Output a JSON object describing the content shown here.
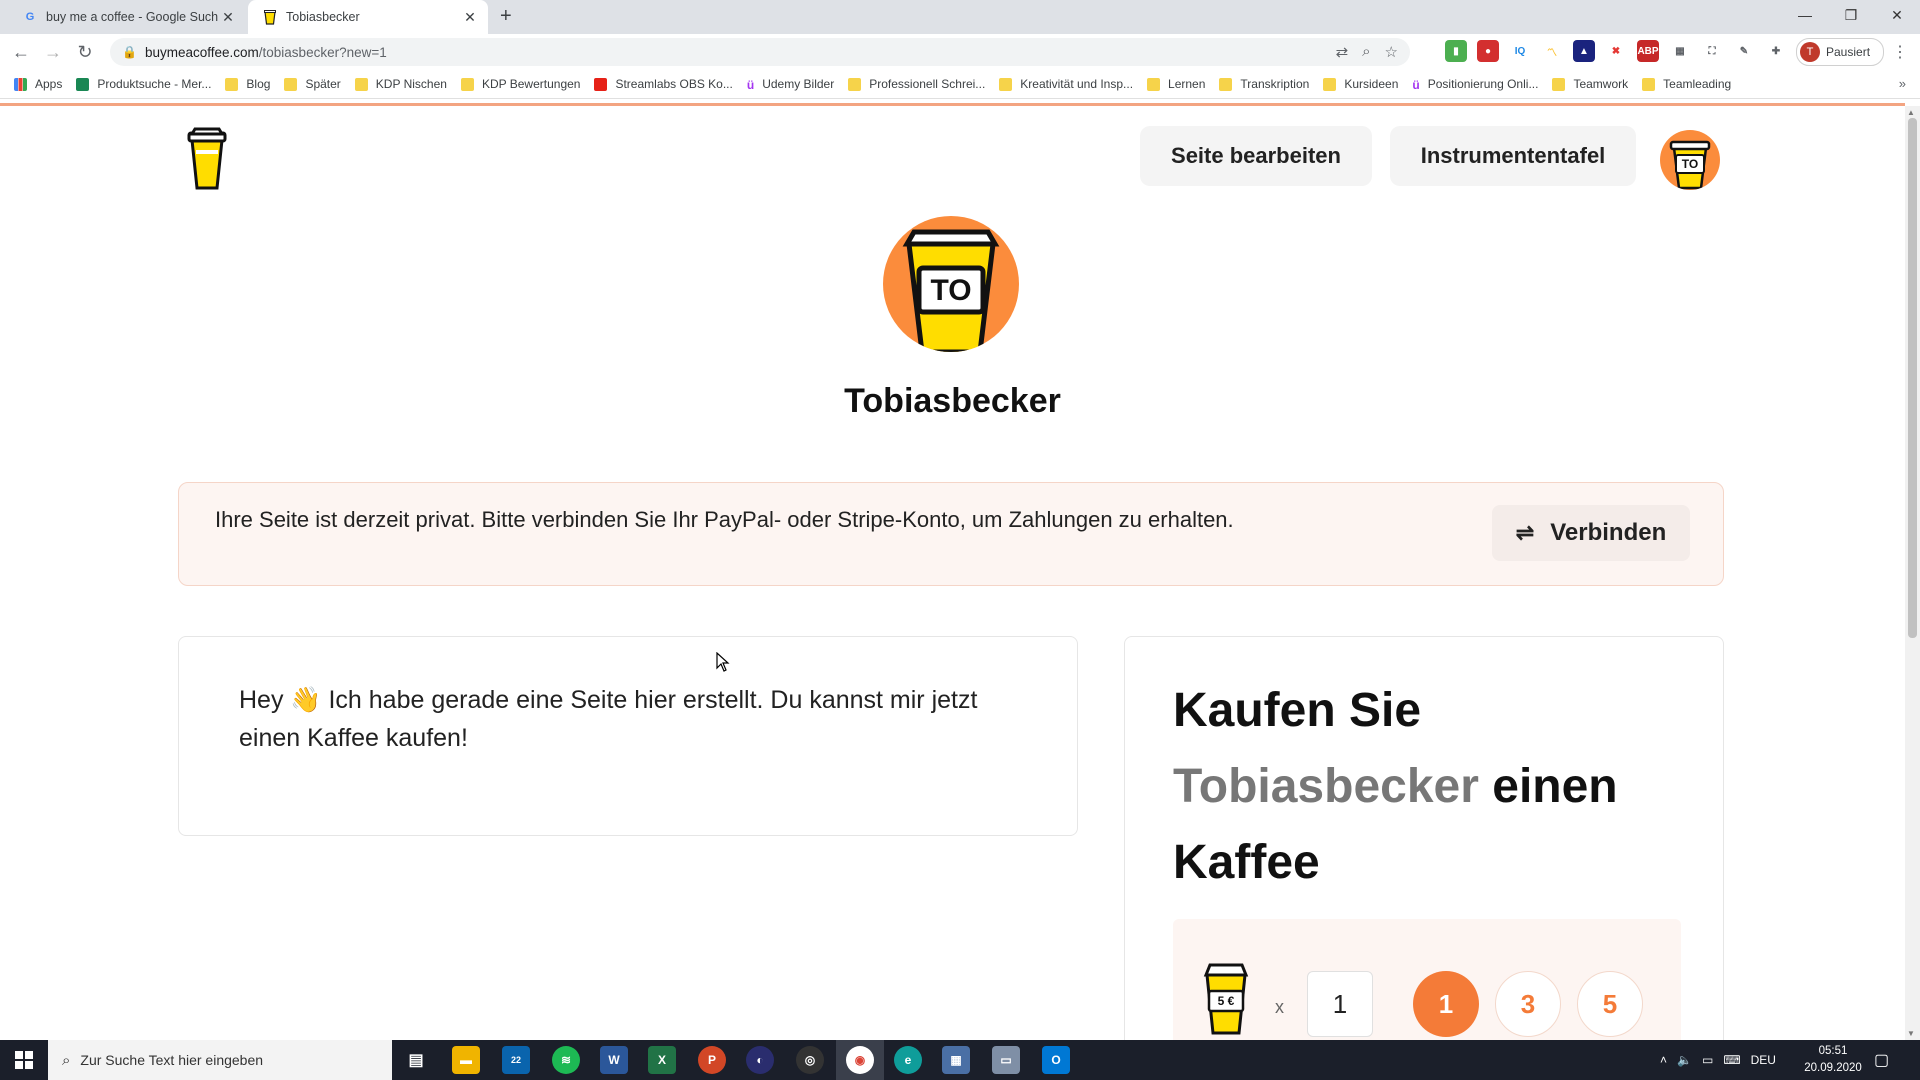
{
  "browser": {
    "tabs": [
      {
        "title": "buy me a coffee - Google Suche",
        "favicon": "G",
        "active": false
      },
      {
        "title": "Tobiasbecker",
        "favicon": "coffee-cup",
        "active": true
      }
    ],
    "new_tab": "+",
    "url_host": "buymeacoffee.com",
    "url_path": "/tobiasbecker?new=1",
    "profile_label": "Pausiert",
    "profile_initial": "T"
  },
  "bookmarks": [
    {
      "label": "Apps",
      "icon": "grid"
    },
    {
      "label": "Produktsuche - Mer...",
      "icon": "green"
    },
    {
      "label": "Blog",
      "icon": "folder"
    },
    {
      "label": "Später",
      "icon": "folder"
    },
    {
      "label": "KDP Nischen",
      "icon": "folder"
    },
    {
      "label": "KDP Bewertungen",
      "icon": "folder"
    },
    {
      "label": "Streamlabs OBS Ko...",
      "icon": "red"
    },
    {
      "label": "Udemy Bilder",
      "icon": "udemy"
    },
    {
      "label": "Professionell Schrei...",
      "icon": "folder"
    },
    {
      "label": "Kreativität und Insp...",
      "icon": "folder"
    },
    {
      "label": "Lernen",
      "icon": "folder"
    },
    {
      "label": "Transkription",
      "icon": "folder"
    },
    {
      "label": "Kursideen",
      "icon": "folder"
    },
    {
      "label": "Positionierung Onli...",
      "icon": "udemy"
    },
    {
      "label": "Teamwork",
      "icon": "folder"
    },
    {
      "label": "Teamleading",
      "icon": "folder"
    }
  ],
  "header": {
    "edit_page": "Seite bearbeiten",
    "dashboard": "Instrumententafel",
    "avatar_text": "TO"
  },
  "profile": {
    "avatar_text": "TO",
    "name": "Tobiasbecker"
  },
  "notice": {
    "text": "Ihre Seite ist derzeit privat. Bitte verbinden Sie Ihr PayPal- oder Stripe-Konto, um Zahlungen zu erhalten.",
    "connect_label": "Verbinden"
  },
  "about": {
    "text": "Hey 👋 Ich habe gerade eine Seite hier erstellt. Du kannst mir jetzt einen Kaffee kaufen!"
  },
  "support": {
    "heading_prefix": "Kaufen Sie",
    "heading_name": "Tobiasbecker",
    "heading_suffix": "einen Kaffee",
    "price_label": "5 €",
    "times": "x",
    "quantity": "1",
    "options": [
      "1",
      "3",
      "5"
    ],
    "selected_option": "1",
    "accent_color": "#f47b38"
  },
  "taskbar": {
    "search_placeholder": "Zur Suche Text hier eingeben",
    "mail_badge": "22",
    "language": "DEU",
    "time": "05:51",
    "date": "20.09.2020"
  }
}
